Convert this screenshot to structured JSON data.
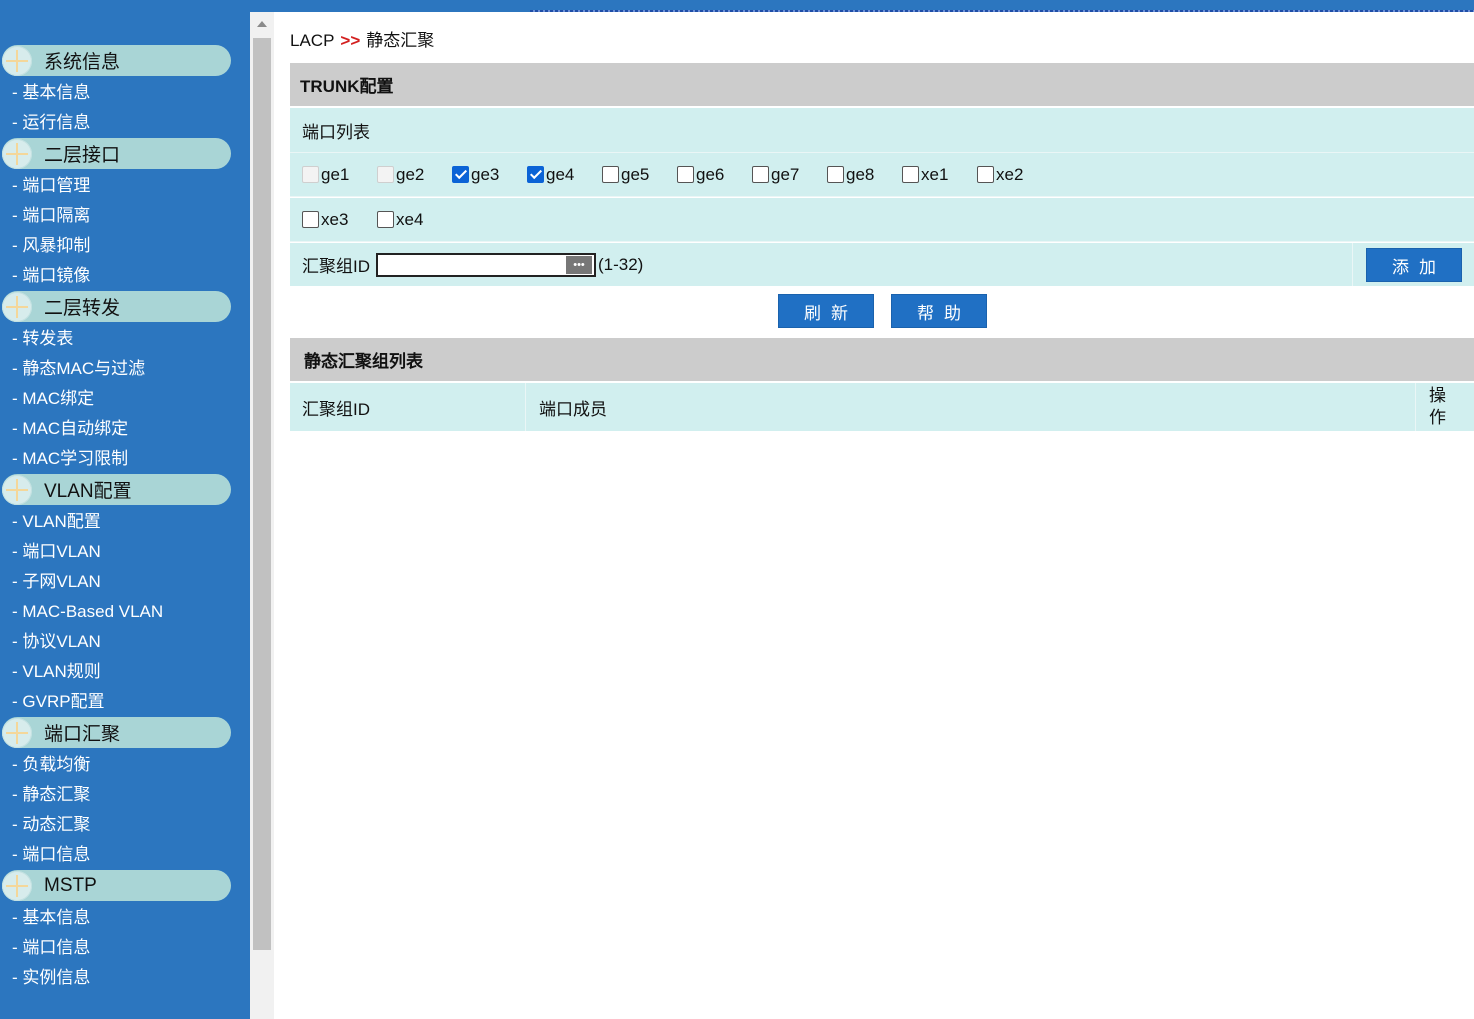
{
  "sidebar": {
    "groups": [
      {
        "label": "系统信息",
        "items": [
          "- 基本信息",
          "- 运行信息"
        ]
      },
      {
        "label": "二层接口",
        "items": [
          "- 端口管理",
          "- 端口隔离",
          "- 风暴抑制",
          "- 端口镜像"
        ]
      },
      {
        "label": "二层转发",
        "items": [
          "- 转发表",
          "- 静态MAC与过滤",
          "- MAC绑定",
          "- MAC自动绑定",
          "- MAC学习限制"
        ]
      },
      {
        "label": "VLAN配置",
        "items": [
          "- VLAN配置",
          "- 端口VLAN",
          "- 子网VLAN",
          "- MAC-Based VLAN",
          "- 协议VLAN",
          "- VLAN规则",
          "- GVRP配置"
        ]
      },
      {
        "label": "端口汇聚",
        "items": [
          "- 负载均衡",
          "- 静态汇聚",
          "- 动态汇聚",
          "- 端口信息"
        ]
      },
      {
        "label": "MSTP",
        "items": [
          "- 基本信息",
          "- 端口信息",
          "- 实例信息"
        ]
      }
    ]
  },
  "breadcrumb": {
    "root": "LACP",
    "separator": ">>",
    "current": "静态汇聚"
  },
  "trunk": {
    "title": "TRUNK配置",
    "port_list_label": "端口列表",
    "ports_row1": [
      {
        "name": "ge1",
        "checked": false,
        "disabled": true
      },
      {
        "name": "ge2",
        "checked": false,
        "disabled": true
      },
      {
        "name": "ge3",
        "checked": true,
        "disabled": false
      },
      {
        "name": "ge4",
        "checked": true,
        "disabled": false
      },
      {
        "name": "ge5",
        "checked": false,
        "disabled": false
      },
      {
        "name": "ge6",
        "checked": false,
        "disabled": false
      },
      {
        "name": "ge7",
        "checked": false,
        "disabled": false
      },
      {
        "name": "ge8",
        "checked": false,
        "disabled": false
      },
      {
        "name": "xe1",
        "checked": false,
        "disabled": false
      },
      {
        "name": "xe2",
        "checked": false,
        "disabled": false
      }
    ],
    "ports_row2": [
      {
        "name": "xe3",
        "checked": false,
        "disabled": false
      },
      {
        "name": "xe4",
        "checked": false,
        "disabled": false
      }
    ],
    "group_id_label": "汇聚组ID",
    "group_id_value": "",
    "group_id_range": "(1-32)",
    "add_button": "添加"
  },
  "actions": {
    "refresh_button": "刷新",
    "help_button": "帮助"
  },
  "static_list": {
    "title": "静态汇聚组列表",
    "columns": [
      "汇聚组ID",
      "端口成员",
      "操作"
    ]
  },
  "colors": {
    "sidebar_bg": "#2c76bf",
    "group_header_bg": "#a9d5d6",
    "row_bg": "#d1efef",
    "section_header_bg": "#cccccc",
    "button_bg": "#2070c4",
    "breadcrumb_separator": "#d32020"
  }
}
